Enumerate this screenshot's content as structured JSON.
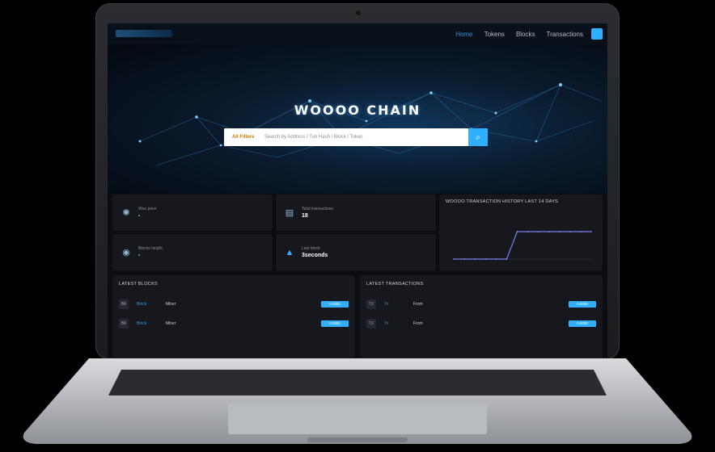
{
  "nav": {
    "items": [
      "Home",
      "Tokens",
      "Blocks",
      "Transactions"
    ]
  },
  "hero": {
    "brand": "WOOOO CHAIN",
    "search_category": "All Filters",
    "search_placeholder": "Search by Address / Txn Hash / Block / Token"
  },
  "stats": {
    "cards": [
      {
        "icon": "globe-icon",
        "label": "Woo price",
        "value": "-"
      },
      {
        "icon": "database-icon",
        "label": "Total transactions",
        "value": "18"
      },
      {
        "icon": "network-icon",
        "label": "Blocks height",
        "value": "-"
      },
      {
        "icon": "triangle-icon",
        "label": "Last block",
        "value": "3seconds"
      }
    ],
    "chart_title": "WOOOO TRANSACTION HISTORY LAST 14 DAYS"
  },
  "blocks": {
    "title": "LATEST BLOCKS",
    "rows": [
      {
        "badge": "BK",
        "col1": "Block",
        "col2": "Miner",
        "pill": "0.0000"
      },
      {
        "badge": "BK",
        "col1": "Block",
        "col2": "Miner",
        "pill": "0.0000"
      }
    ]
  },
  "transactions": {
    "title": "LATEST TRANSACTIONS",
    "rows": [
      {
        "badge": "TX",
        "col1": "Tx",
        "col2": "From",
        "pill": "0.0000"
      },
      {
        "badge": "TX",
        "col1": "Tx",
        "col2": "From",
        "pill": "0.0000"
      }
    ]
  },
  "colors": {
    "accent": "#2fb0ff",
    "background": "#0b0d12",
    "card": "#16181d"
  },
  "chart_data": {
    "type": "line",
    "title": "WOOOO TRANSACTION HISTORY LAST 14 DAYS",
    "x": [
      1,
      2,
      3,
      4,
      5,
      6,
      7,
      8,
      9,
      10,
      11,
      12,
      13,
      14
    ],
    "series": [
      {
        "values": [
          0,
          0,
          0,
          0,
          0,
          0,
          1,
          1,
          1,
          1,
          1,
          1,
          1,
          1
        ]
      }
    ]
  }
}
